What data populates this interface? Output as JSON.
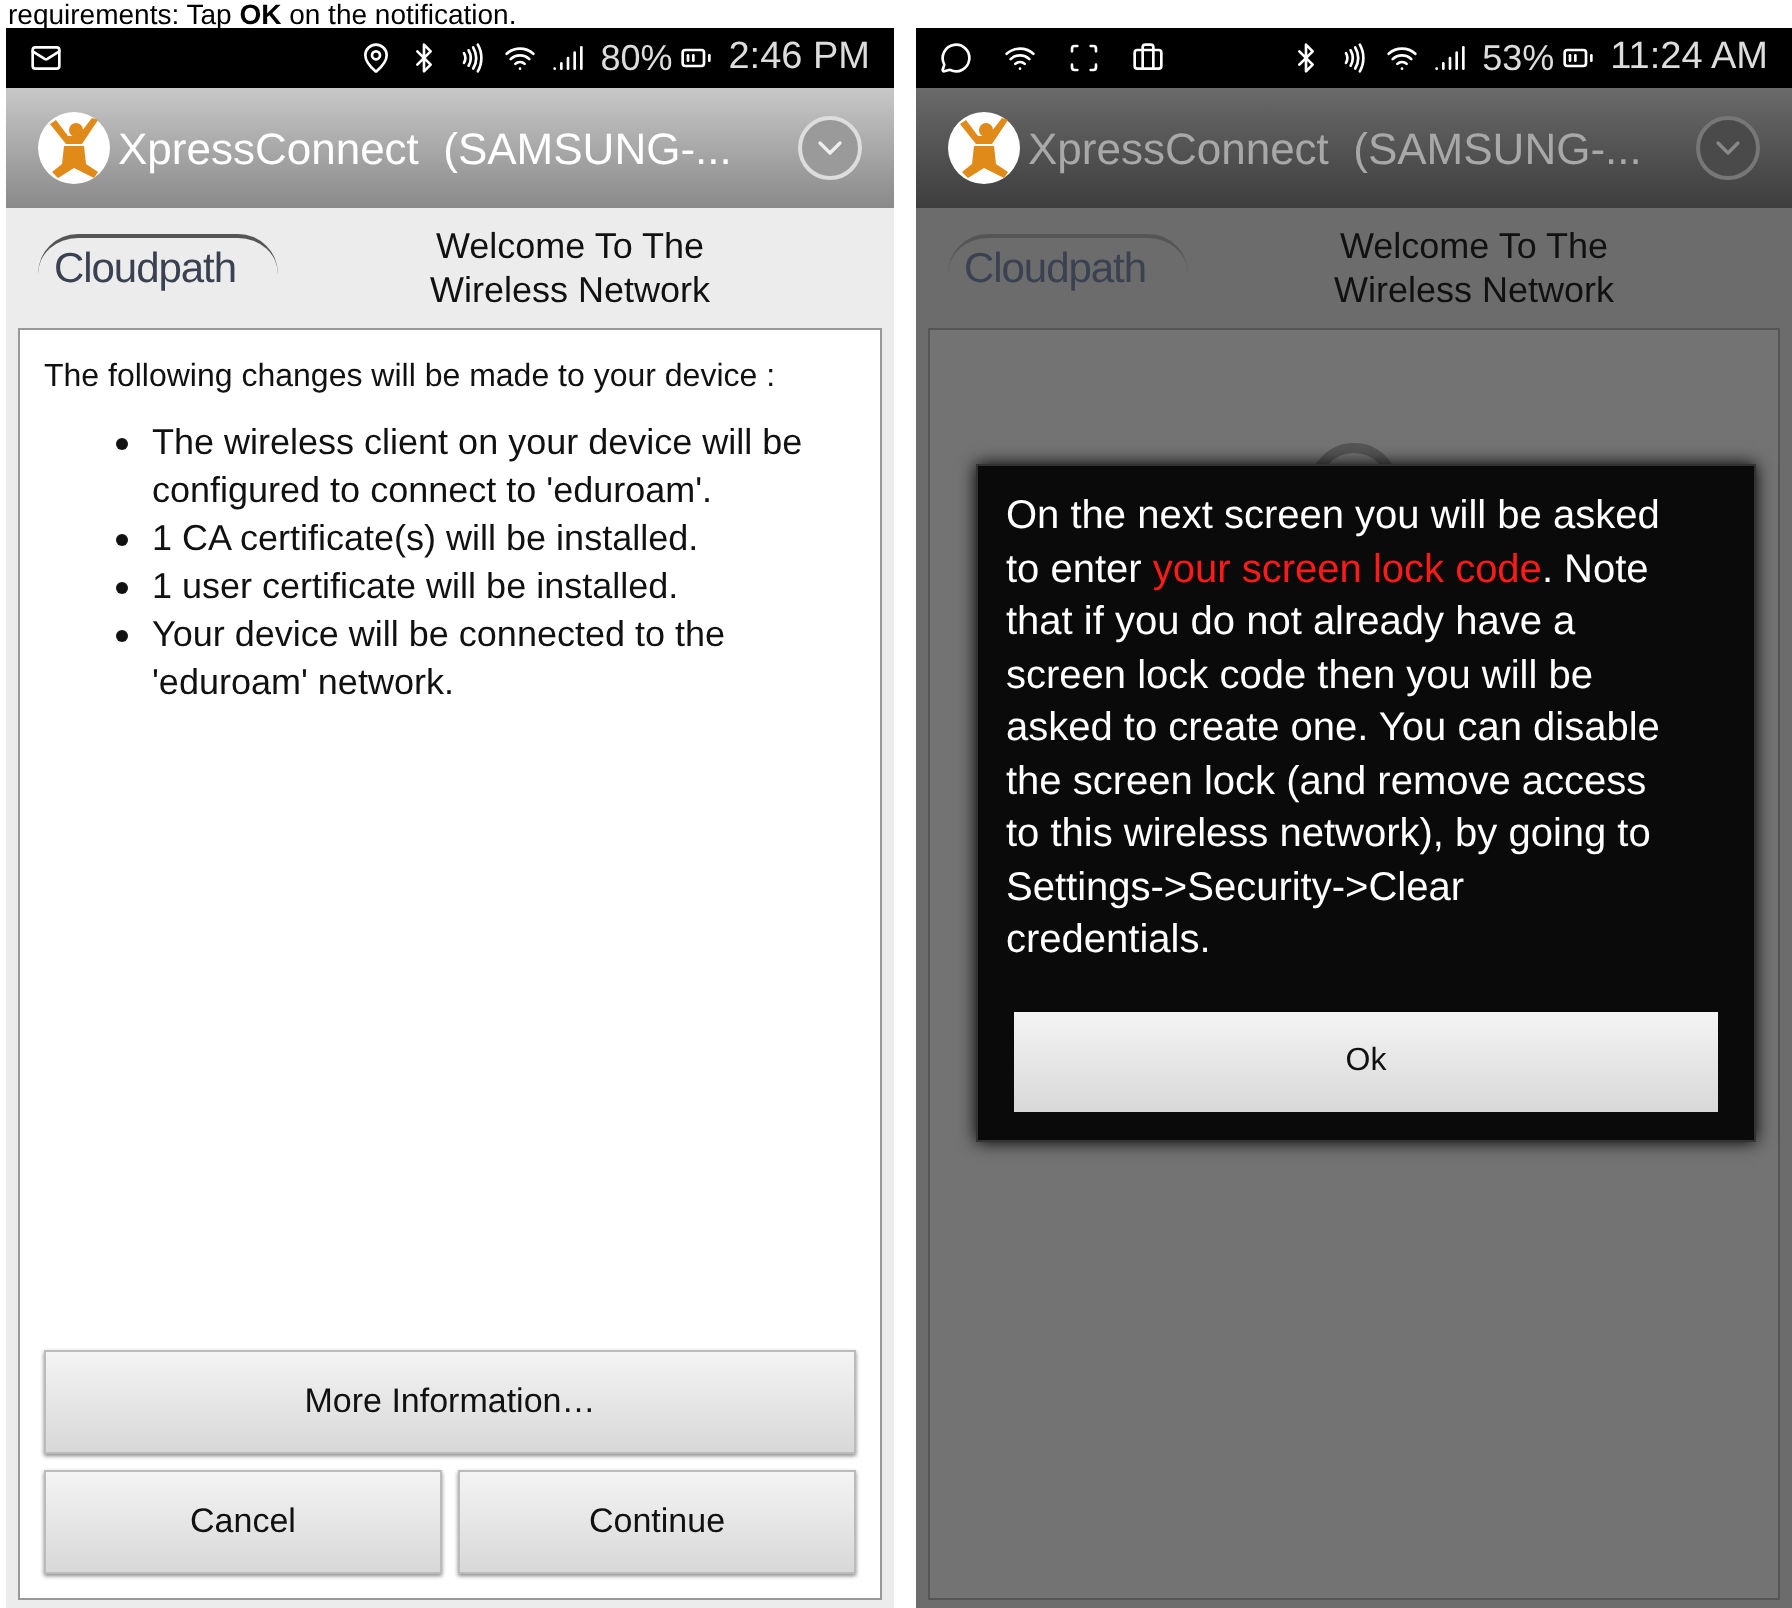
{
  "caption": "requirements: Tap **OK** on the notification.",
  "left": {
    "status_bar": {
      "time": "2:46 PM",
      "battery": "80%"
    },
    "app_bar": {
      "title": "XpressConnect  (SAMSUNG-..."
    },
    "header": {
      "logo": "Cloudpath",
      "title": "Welcome To The Wireless Network"
    },
    "intro": "The following changes will be made to your device :",
    "changes": [
      "The wireless client on your device will be configured to connect to 'eduroam'.",
      "1 CA certificate(s) will be installed.",
      "1 user certificate will be installed.",
      "Your device will be connected to the 'eduroam' network."
    ],
    "more_button": "More Information…",
    "buttons": [
      "Cancel",
      "Continue"
    ]
  },
  "right": {
    "status_bar": {
      "time": "11:24 AM",
      "battery": "53%"
    },
    "app_bar": {
      "title": "XpressConnect  (SAMSUNG-..."
    },
    "header": {
      "logo": "Cloudpath",
      "title": "Welcome To The Wireless Network"
    },
    "dialog": {
      "message": [
        {
          "text": "On the next screen you will be asked to enter ",
          "highlight": false
        },
        {
          "text": "your screen lock code",
          "highlight": true
        },
        {
          "text": ". Note that if you do not already have a screen lock code then you will be asked to create one. You can disable the screen lock (and remove access to this wireless network), by going to Settings->Security->Clear credentials.",
          "highlight": false
        }
      ],
      "button": "Ok"
    }
  }
}
